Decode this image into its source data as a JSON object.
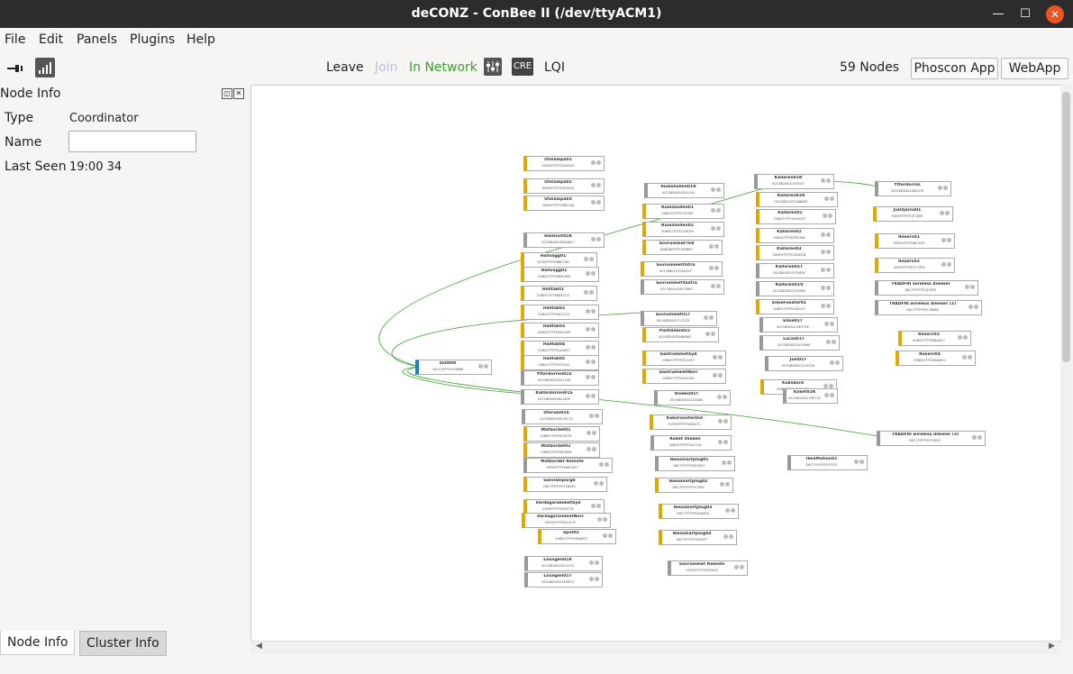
{
  "window": {
    "title": "deCONZ - ConBee II (/dev/ttyACM1)"
  },
  "menu": [
    "File",
    "Edit",
    "Panels",
    "Plugins",
    "Help"
  ],
  "toolbar": {
    "leave": "Leave",
    "join": "Join",
    "status": "In Network",
    "cre": "CRE",
    "lqi": "LQI",
    "nodes": "59 Nodes",
    "phoscon": "Phoscon App",
    "webapp": "WebApp"
  },
  "colors": {
    "network_green": "#3aa12b",
    "join_disabled": "#c0b8e0",
    "node_yellow": "#e2a800",
    "node_gray": "#999999",
    "coordinator_blue": "#1a7fd0",
    "title_bar": "#2c2c2c",
    "close_orange": "#e95420"
  },
  "node_info": {
    "title": "Node Info",
    "type_label": "Type",
    "type_value": "Coordinator",
    "name_label": "Name",
    "name_value": "",
    "lastseen_label": "Last Seen",
    "lastseen_value": "19:00 34"
  },
  "tabs": [
    "Node Info",
    "Cluster Info"
  ],
  "graph_nodes": [
    {
      "name": "0x0000",
      "addr": "00212EFFFF058888",
      "style": "blue"
    },
    {
      "name": "Utelampa01",
      "addr": "00B057FFFE0A4B29",
      "style": "yellow"
    },
    {
      "name": "Utelampa02",
      "addr": "00B057FFFE9F43A9",
      "style": "yellow"
    },
    {
      "name": "Utelampa03",
      "addr": "00B057FFFE8BE1D6",
      "style": "yellow"
    },
    {
      "name": "Hallsnöt01R",
      "addr": "00158D0005D55B47",
      "style": "gray"
    },
    {
      "name": "Hallvägg01",
      "addr": "90FDFFFFFE8BE79D",
      "style": "yellow"
    },
    {
      "name": "Hallvägg02",
      "addr": "00B057FFFE8BE3B6",
      "style": "yellow"
    },
    {
      "name": "Halltak01",
      "addr": "00B057FFFE8BE2C5",
      "style": "yellow"
    },
    {
      "name": "Halltak02",
      "addr": "00B057FFFE8E7C75",
      "style": "yellow"
    },
    {
      "name": "Halltak03",
      "addr": "00B057FFFE0AD7B9",
      "style": "yellow"
    },
    {
      "name": "Halltak04",
      "addr": "00B057FFFE0AC857",
      "style": "yellow"
    },
    {
      "name": "Halltak05",
      "addr": "00B057FFFE9F41A9",
      "style": "yellow"
    },
    {
      "name": "Ytterdorren01S",
      "addr": "00158D0005A41256",
      "style": "gray"
    },
    {
      "name": "Källardörren01S",
      "addr": "00158D0003B41B2E",
      "style": "gray"
    },
    {
      "name": "Uterum01S",
      "addr": "00158D0003E1BC32",
      "style": "gray"
    },
    {
      "name": "Matbordet01",
      "addr": "14B657FFFE8787DF",
      "style": "yellow"
    },
    {
      "name": "Matbordet02",
      "addr": "14B657FFFE6F0858",
      "style": "yellow"
    },
    {
      "name": "Matbordet Remote",
      "addr": "90FDFFFFFE8BC0E7",
      "style": "gray"
    },
    {
      "name": "Golvlampargb",
      "addr": "D8C7FFFFFE33B085",
      "style": "yellow"
    },
    {
      "name": "VardagsrummetSyd",
      "addr": "90FDFFFFFE92FF7B",
      "style": "yellow"
    },
    {
      "name": "VardagsrummetNorr",
      "addr": "90FDFFFFFE92917F",
      "style": "yellow"
    },
    {
      "name": "Spot01",
      "addr": "00B057FFFE9BA603",
      "style": "yellow"
    },
    {
      "name": "Loungen01R",
      "addr": "00158D0002E51470",
      "style": "gray"
    },
    {
      "name": "Loungen01T",
      "addr": "00158D00023E3BCC",
      "style": "gray"
    },
    {
      "name": "Rumshallen01R",
      "addr": "00158D0002E51404",
      "style": "gray"
    },
    {
      "name": "Rumshallen01",
      "addr": "00B057FFFEC0236F",
      "style": "yellow"
    },
    {
      "name": "Rumshallen02",
      "addr": "00B057FFFEC0D0F9",
      "style": "yellow"
    },
    {
      "name": "Sovrummet768",
      "addr": "D0BD6FFFFE3E5B87",
      "style": "yellow"
    },
    {
      "name": "SovrummetÖstra",
      "addr": "00178801037D051F",
      "style": "yellow"
    },
    {
      "name": "SovrummetVästra",
      "addr": "0017880103E4768C",
      "style": "gray"
    },
    {
      "name": "Sovrummet01T",
      "addr": "00158D0002713228",
      "style": "gray"
    },
    {
      "name": "Postlådan01v",
      "addr": "00158D00028D8B62",
      "style": "yellow"
    },
    {
      "name": "GästrummetSyd",
      "addr": "00B057FFFE921093",
      "style": "yellow"
    },
    {
      "name": "GästrummetNorr",
      "addr": "00B057FFFE9A5700",
      "style": "yellow"
    },
    {
      "name": "Vinden01T",
      "addr": "00158D0002222880",
      "style": "gray"
    },
    {
      "name": "KoksFonsterDot",
      "addr": "90FDFFFFFE0D0A72",
      "style": "yellow"
    },
    {
      "name": "Köket Vasken",
      "addr": "00B057FFFE9AC23A",
      "style": "gray"
    },
    {
      "name": "Ikeasmartplug01",
      "addr": "D8C7FFFFFE8F0E57",
      "style": "gray"
    },
    {
      "name": "Ikeasmartplug02",
      "addr": "D8C7FFFFFE5F7958",
      "style": "yellow"
    },
    {
      "name": "Ikeasmartplug03",
      "addr": "D8C7FFFFFE4DA0EA",
      "style": "yellow"
    },
    {
      "name": "Ikeasmartplug04",
      "addr": "D8C7FFFFFE55E5FF",
      "style": "yellow"
    },
    {
      "name": "Sovrummet Remote",
      "addr": "90FDFFFFFE5A69C8",
      "style": "gray"
    },
    {
      "name": "Källaren01R",
      "addr": "00158D000225301F",
      "style": "gray"
    },
    {
      "name": "Källaren02R",
      "addr": "00158D00023AB8D9",
      "style": "yellow"
    },
    {
      "name": "Källaren01",
      "addr": "00B057FFFE0A553F",
      "style": "yellow"
    },
    {
      "name": "Källaren02",
      "addr": "00B057FFFE9BE386",
      "style": "yellow"
    },
    {
      "name": "Källaren03",
      "addr": "00B057FFFEC0DD2B",
      "style": "yellow"
    },
    {
      "name": "Källaren01T",
      "addr": "00158D0001F5360E",
      "style": "gray"
    },
    {
      "name": "Källaren01V",
      "addr": "00158D00022309B3",
      "style": "gray"
    },
    {
      "name": "ElineFönster01",
      "addr": "00B057FFFE0A6252",
      "style": "yellow"
    },
    {
      "name": "Eline01T",
      "addr": "00158D00023E370E",
      "style": "gray"
    },
    {
      "name": "Lucas01T",
      "addr": "00158D0002A3366E",
      "style": "gray"
    },
    {
      "name": "Joel01T",
      "addr": "00158D0002222526",
      "style": "gray"
    },
    {
      "name": "Köksbord",
      "addr": "00B057FFFE8A4C8D",
      "style": "yellow"
    },
    {
      "name": "Köket01R",
      "addr": "00158D000229EC31",
      "style": "gray"
    },
    {
      "name": "IkeaMotion01",
      "addr": "D8C7FFFFFE457E7E",
      "style": "gray"
    },
    {
      "name": "Ytterdörräs",
      "addr": "00158D00024B42FD",
      "style": "gray"
    },
    {
      "name": "Julstjarna01",
      "addr": "90FDFFFFFE1FCB5E",
      "style": "yellow"
    },
    {
      "name": "Reserv01",
      "addr": "90FDFFFFFE8B7A7E",
      "style": "yellow"
    },
    {
      "name": "Reserv02",
      "addr": "90FDFFFFFE3775F6",
      "style": "yellow"
    },
    {
      "name": "TRADFRI wireless dimmer",
      "addr": "D8C7FFFFFE2F9FEE",
      "style": "gray"
    },
    {
      "name": "TRADFRI wireless dimmer (2)",
      "addr": "D8C7FFFFFE07B688",
      "style": "gray"
    },
    {
      "name": "Reserv03",
      "addr": "00B057FFFE0BA6C7",
      "style": "yellow"
    },
    {
      "name": "Reserv04",
      "addr": "00B057FFFE0BA620",
      "style": "yellow"
    },
    {
      "name": "TRADFRI wireless dimmer (3)",
      "addr": "D8C7FFFFFE030E0C",
      "style": "gray"
    }
  ]
}
